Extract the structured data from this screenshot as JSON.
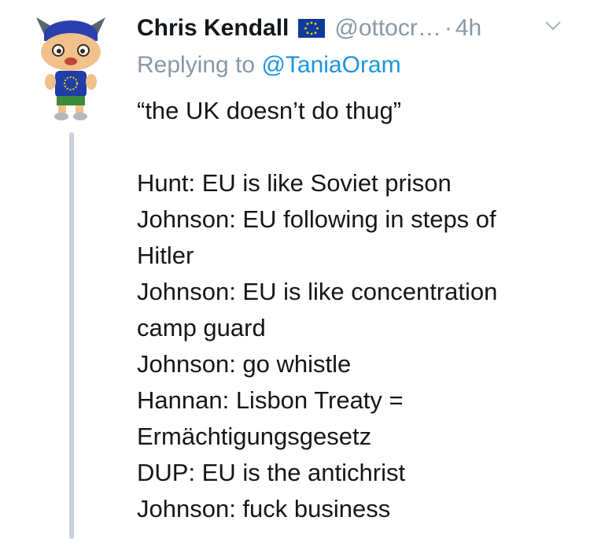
{
  "tweet": {
    "display_name": "Chris Kendall",
    "handle": "@ottocr…",
    "separator": "·",
    "time": "4h",
    "reply_prefix": "Replying to",
    "reply_to": "@TaniaOram",
    "lines": [
      "“the UK doesn’t do thug”",
      "",
      "Hunt: EU is like Soviet prison",
      "Johnson: EU following in steps of",
      "Hitler",
      "Johnson: EU is like concentration",
      "camp guard",
      "Johnson: go whistle",
      "Hannan: Lisbon Treaty =",
      "Ermächtigungsgesetz",
      "DUP: EU is the antichrist",
      "Johnson: fuck business"
    ]
  },
  "icons": {
    "avatar": "animal-crossing-villager-avatar",
    "flag": "eu-flag-icon",
    "menu": "chevron-down-icon"
  },
  "colors": {
    "text": "#14171a",
    "secondary": "#8a98a6",
    "link": "#1b95e0",
    "thread_line": "#c8d2dc",
    "flag_blue": "#0d3b9c",
    "flag_star": "#f5d100"
  }
}
